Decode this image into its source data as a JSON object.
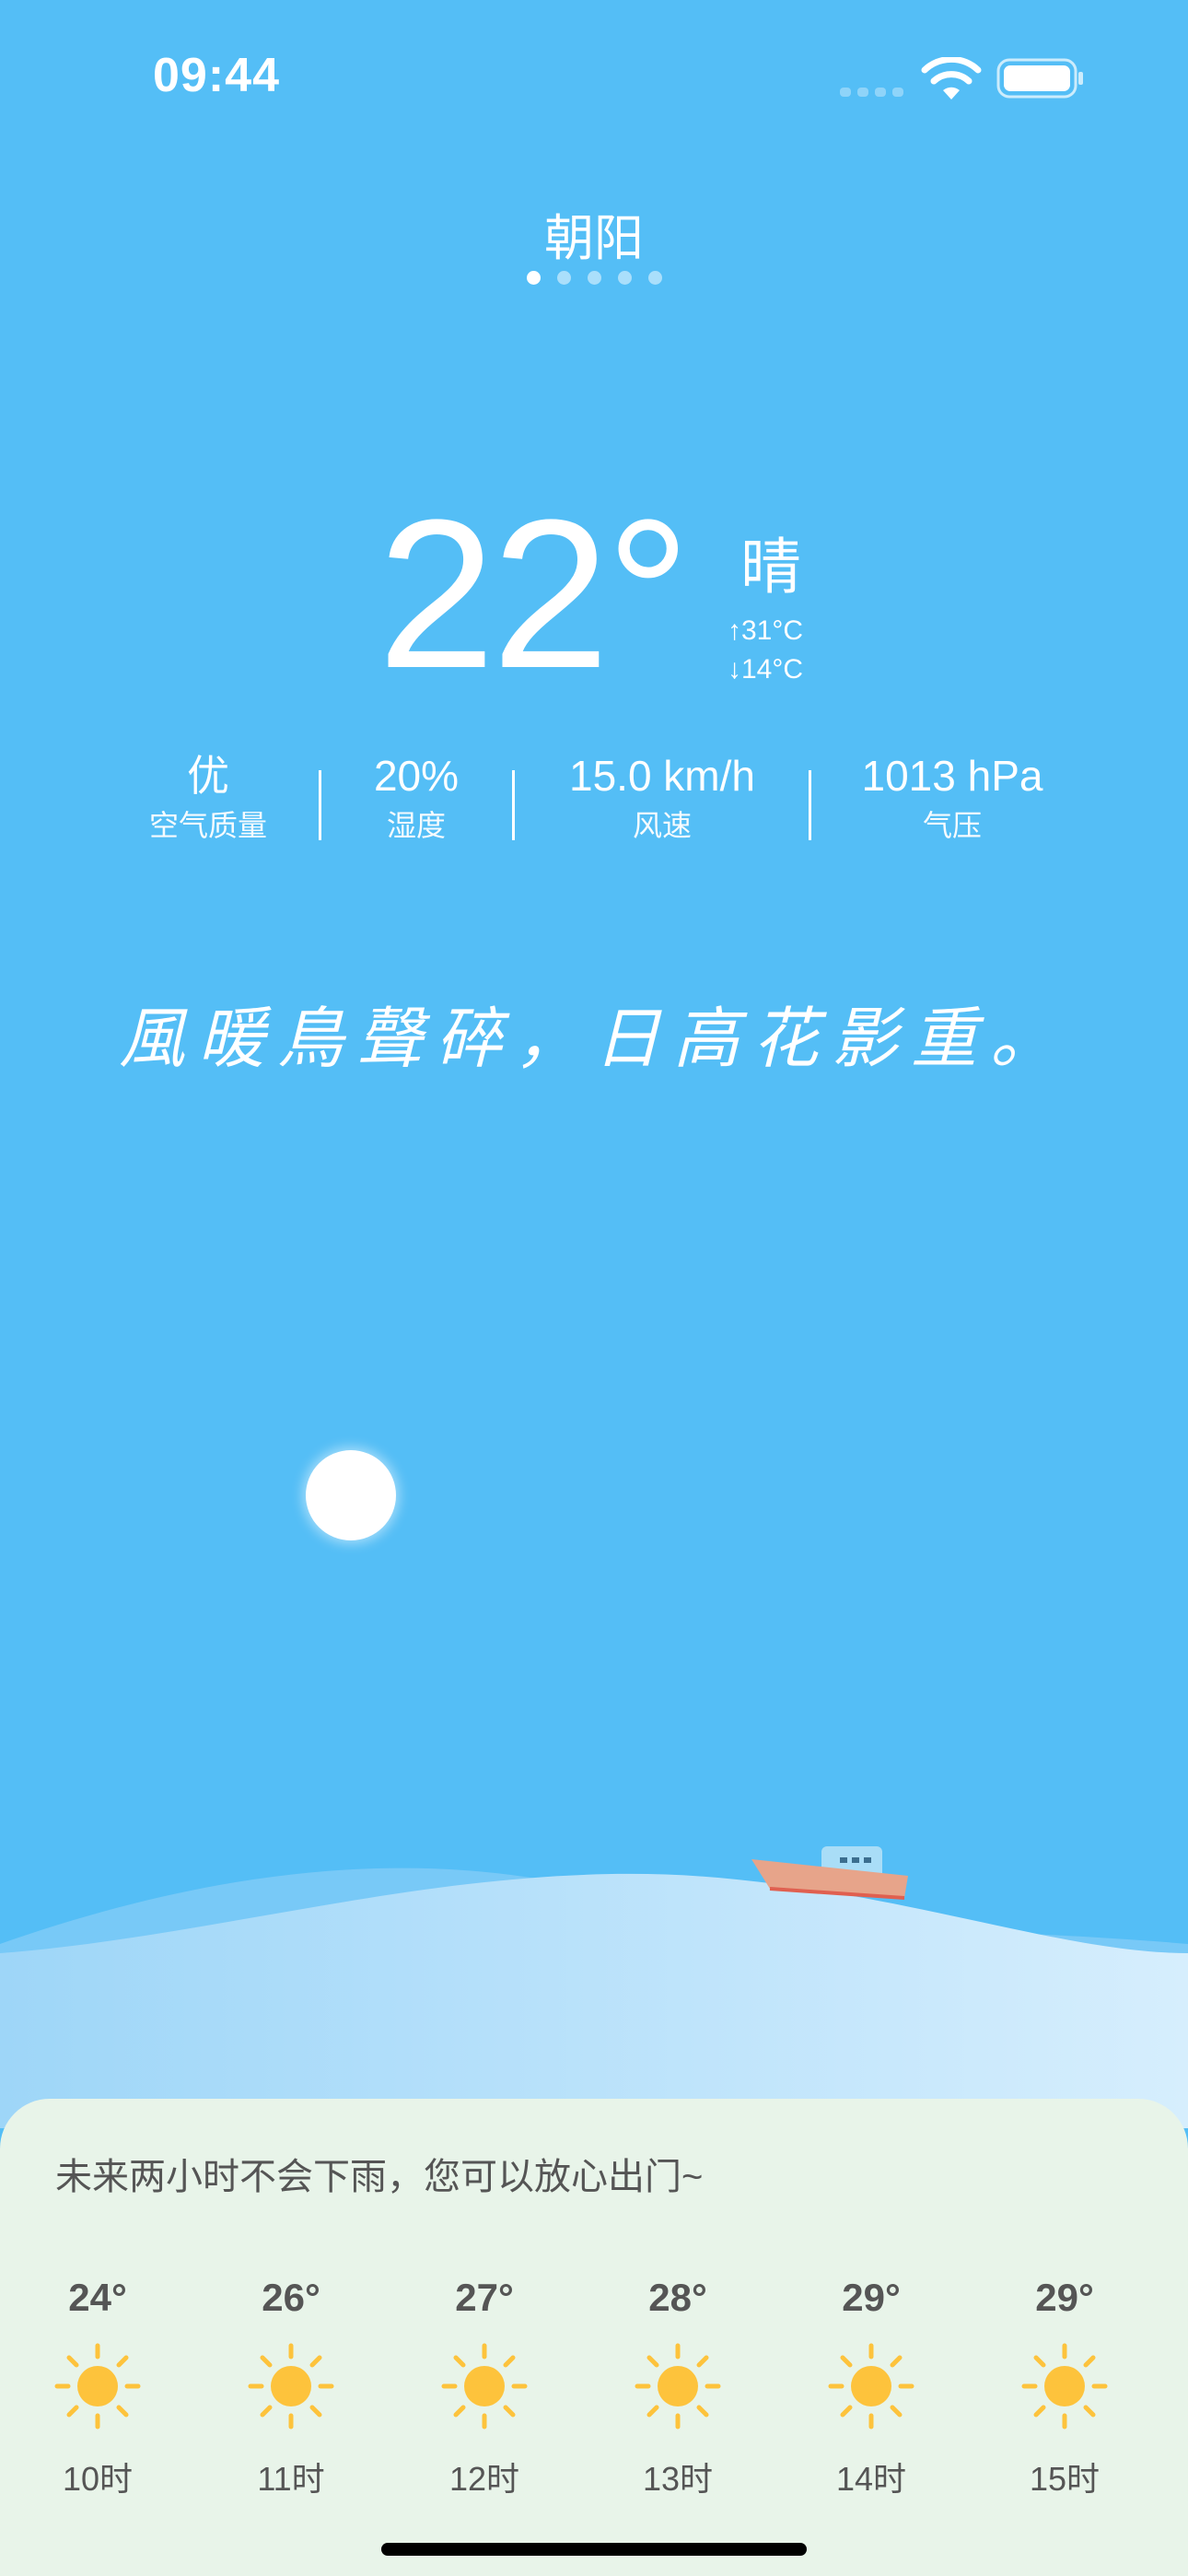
{
  "status_bar": {
    "time": "09:44",
    "icons": [
      "signal-icon",
      "wifi-icon",
      "battery-icon"
    ]
  },
  "header": {
    "city": "朝阳",
    "page_count": 5,
    "active_page": 1
  },
  "current": {
    "temperature": "22°",
    "condition": "晴",
    "high": "↑31°C",
    "low": "↓14°C"
  },
  "stats": [
    {
      "value": "优",
      "label": "空气质量"
    },
    {
      "value": "20%",
      "label": "湿度"
    },
    {
      "value": "15.0 km/h",
      "label": "风速"
    },
    {
      "value": "1013 hPa",
      "label": "气压"
    }
  ],
  "poem": "風暖鳥聲碎，日高花影重。",
  "forecast": {
    "note": "未来两小时不会下雨，您可以放心出门~",
    "hours": [
      {
        "temp": "24°",
        "label": "10时",
        "icon": "sun-icon"
      },
      {
        "temp": "26°",
        "label": "11时",
        "icon": "sun-icon"
      },
      {
        "temp": "27°",
        "label": "12时",
        "icon": "sun-icon"
      },
      {
        "temp": "28°",
        "label": "13时",
        "icon": "sun-icon"
      },
      {
        "temp": "29°",
        "label": "14时",
        "icon": "sun-icon"
      },
      {
        "temp": "29°",
        "label": "15时",
        "icon": "sun-icon"
      }
    ]
  },
  "colors": {
    "sky": "#54BEF6",
    "card": "#E8F4E9",
    "sun_icon": "#FDC33C"
  }
}
